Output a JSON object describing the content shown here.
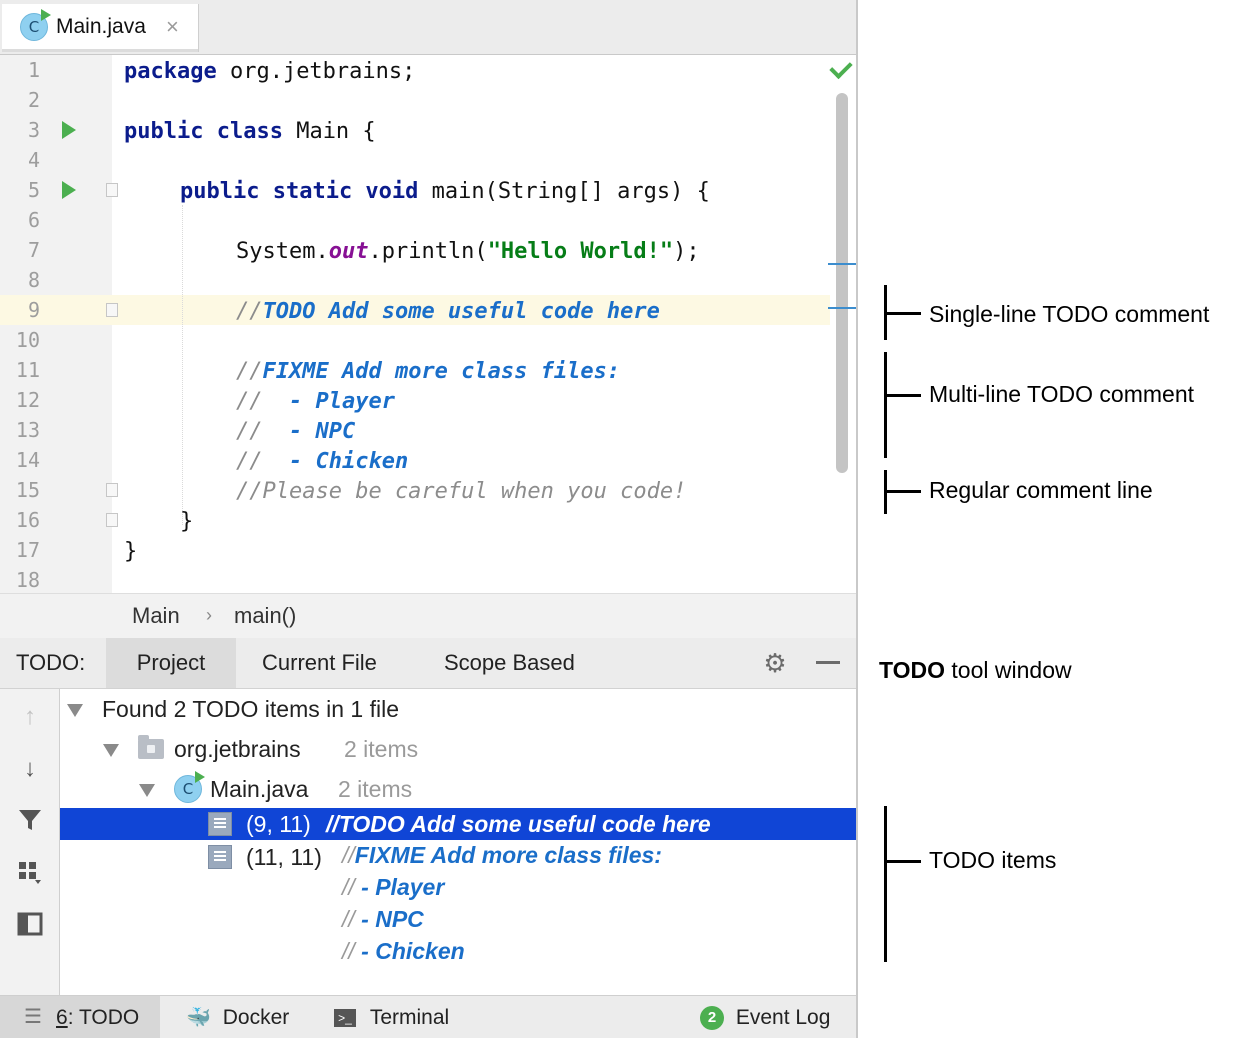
{
  "editor_tab": {
    "icon": "java-class-icon",
    "icon_letter": "C",
    "label": "Main.java",
    "close": "×"
  },
  "editor": {
    "line_numbers": [
      "1",
      "2",
      "3",
      "4",
      "5",
      "6",
      "7",
      "8",
      "9",
      "10",
      "11",
      "12",
      "13",
      "14",
      "15",
      "16",
      "17",
      "18"
    ],
    "code": {
      "l1_kw": "package",
      "l1_rest": " org.jetbrains;",
      "l3_kw": "public class",
      "l3_rest": " Main {",
      "l5_kw": "public static void",
      "l5_rest": " main(String[] args) {",
      "l7_a": "System.",
      "l7_field": "out",
      "l7_b": ".println(",
      "l7_str": "\"Hello World!\"",
      "l7_c": ");",
      "l9_slash": "//",
      "l9_todo": "TODO Add some useful code here",
      "l11_slash": "//",
      "l11_todo": "FIXME Add more class files:",
      "l12_slash": "// ",
      "l12_todo": " - Player",
      "l13_slash": "// ",
      "l13_todo": " - NPC",
      "l14_slash": "// ",
      "l14_todo": " - Chicken",
      "l15_cmt": "//Please be careful when you code!",
      "l16": "}",
      "l17": "}"
    }
  },
  "breadcrumbs": {
    "class": "Main",
    "separator": "›",
    "method": "main()"
  },
  "todo_window": {
    "label": "TODO:",
    "tabs": [
      "Project",
      "Current File",
      "Scope Based"
    ],
    "active_tab": "Project",
    "tree": {
      "root": "Found 2 TODO items in 1 file",
      "package": {
        "name": "org.jetbrains",
        "count": "2 items"
      },
      "file": {
        "name": "Main.java",
        "count": "2 items"
      },
      "item1": {
        "pos": "(9, 11)",
        "slash": "//",
        "text": "TODO Add some useful code here"
      },
      "item2": {
        "pos": "(11, 11)",
        "lines": [
          {
            "slash": "//",
            "text": "FIXME Add more class files:"
          },
          {
            "slash": "//",
            "text": " - Player"
          },
          {
            "slash": "//",
            "text": " - NPC"
          },
          {
            "slash": "//",
            "text": " - Chicken"
          }
        ]
      }
    }
  },
  "status_bar": {
    "todo_num": "6",
    "todo_rest": ": TODO",
    "docker": "Docker",
    "terminal": "Terminal",
    "event_count": "2",
    "event_log": "Event Log"
  },
  "annotations": {
    "single_line": "Single-line TODO comment",
    "multi_line": "Multi-line TODO comment",
    "regular": "Regular comment line",
    "tool_window_bold": "TODO",
    "tool_window_rest": " tool window",
    "items": "TODO items"
  },
  "colors": {
    "todo_text": "#1a6ec9",
    "selection": "#1045d6",
    "keyword": "#0b1c8c",
    "string": "#067d17",
    "run_icon": "#4caf50"
  }
}
